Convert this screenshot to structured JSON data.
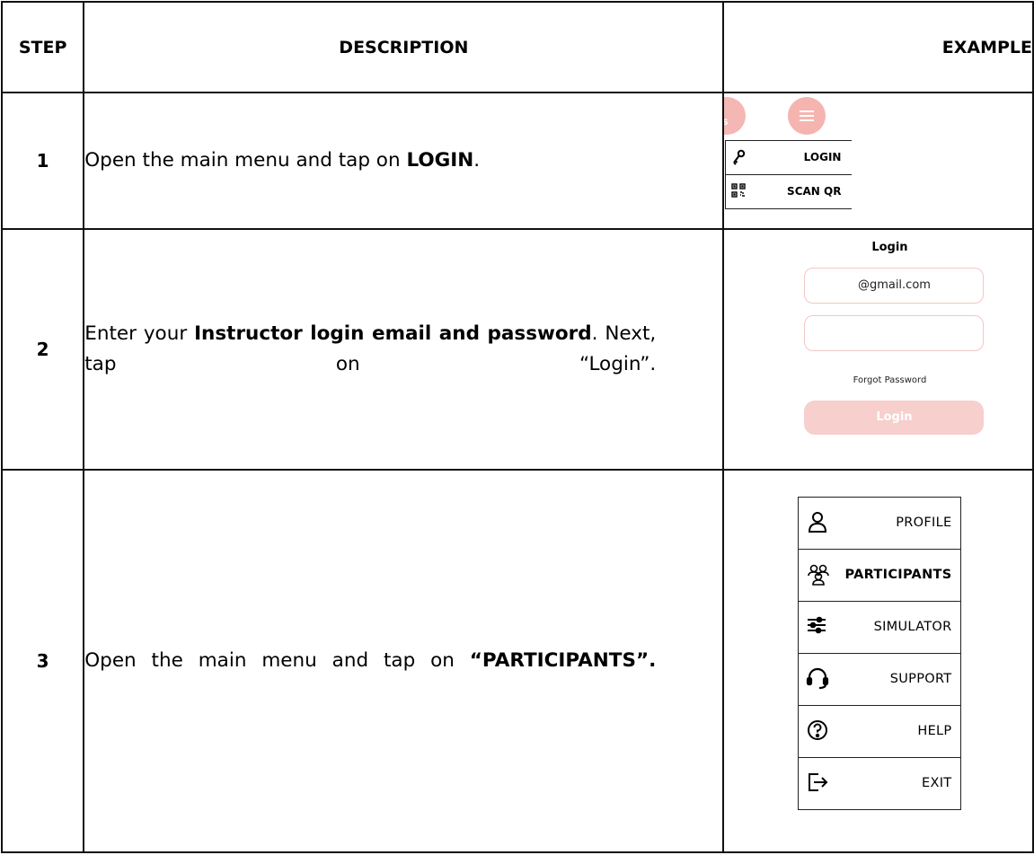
{
  "headers": {
    "step": "STEP",
    "description": "DESCRIPTION",
    "example": "EXAMPLE"
  },
  "rows": [
    {
      "step": "1",
      "description": {
        "pre": "Open the main menu and tap on ",
        "bold": "LOGIN",
        "post": "."
      },
      "example": {
        "menu_items": [
          {
            "label": "LOGIN",
            "icon": "key-icon"
          },
          {
            "label": "SCAN QR",
            "icon": "qr-code-icon"
          }
        ],
        "buttons": [
          {
            "icon": "logo-icon"
          },
          {
            "icon": "hamburger-menu-icon"
          }
        ]
      }
    },
    {
      "step": "2",
      "description": {
        "pre": "Enter your ",
        "bold": "Instructor login email and password",
        "post": ". Next, tap on “Login”."
      },
      "example": {
        "title": "Login",
        "email_value": "@gmail.com",
        "password_value": "",
        "forgot_label": "Forgot Password",
        "login_button": "Login"
      }
    },
    {
      "step": "3",
      "description": {
        "pre": "Open the main menu and tap on ",
        "bold": "“PARTICIPANTS”."
      },
      "example": {
        "menu_items": [
          {
            "label": "PROFILE",
            "icon": "user-icon"
          },
          {
            "label": "PARTICIPANTS",
            "icon": "group-icon"
          },
          {
            "label": "SIMULATOR",
            "icon": "sliders-icon"
          },
          {
            "label": "SUPPORT",
            "icon": "headset-icon"
          },
          {
            "label": "HELP",
            "icon": "question-icon"
          },
          {
            "label": "EXIT",
            "icon": "exit-icon"
          }
        ]
      }
    }
  ],
  "colors": {
    "accent": "#f5b4b0",
    "field_border": "#f2c7c3",
    "login_button": "#f7cfcd"
  }
}
